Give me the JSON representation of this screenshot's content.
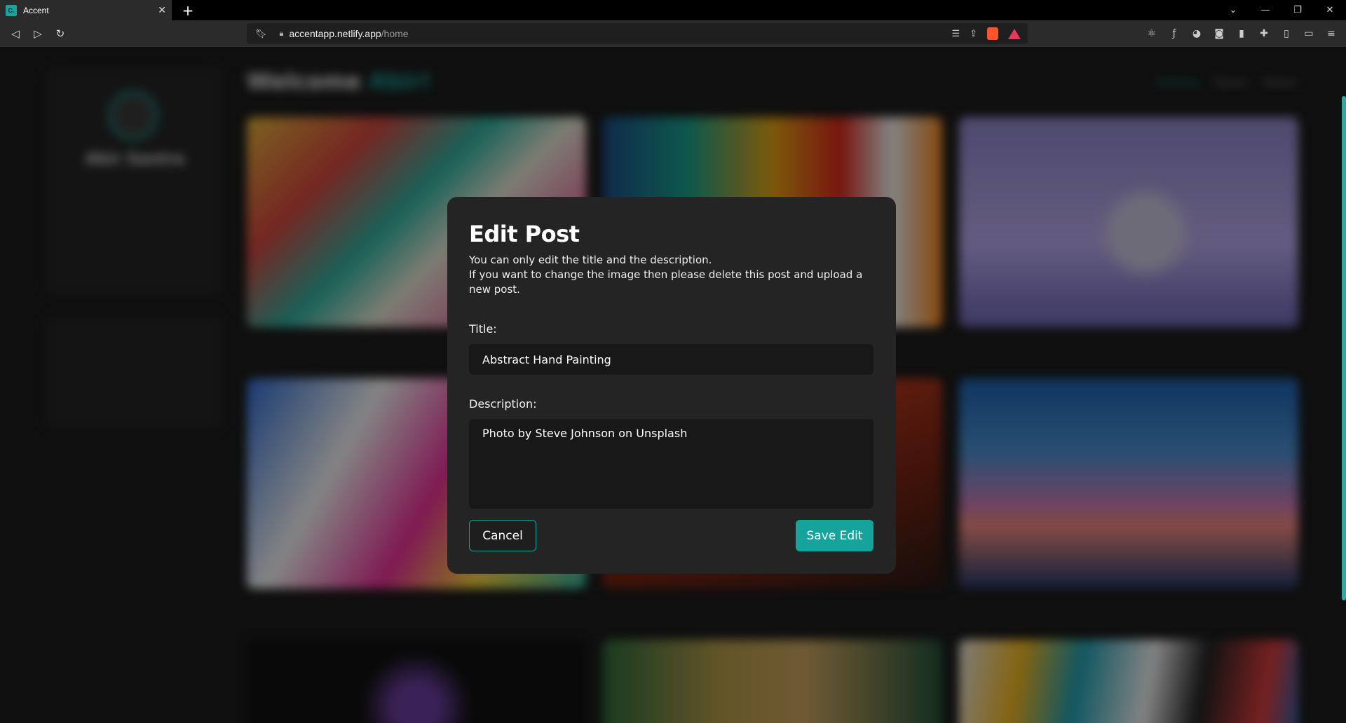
{
  "browser": {
    "tab_title": "Accent",
    "favicon_text": "C.",
    "url_host": "accentapp.netlify.app",
    "url_path": "/home"
  },
  "background": {
    "welcome_prefix": "Welcome ",
    "welcome_name": "Abir",
    "welcome_suffix": "!",
    "profile_name": "Abir Santra",
    "feed_tabs": [
      "Following",
      "Popular",
      "Newest"
    ],
    "accent_color": "#16a39c"
  },
  "modal": {
    "title": "Edit Post",
    "description_line1": "You can only edit the title and the description.",
    "description_line2": "If you want to change the image then please delete this post and upload a new post.",
    "title_label": "Title:",
    "title_value": "Abstract Hand Painting",
    "description_label": "Description:",
    "description_value": "Photo by Steve Johnson on Unsplash",
    "cancel_label": "Cancel",
    "save_label": "Save Edit"
  }
}
